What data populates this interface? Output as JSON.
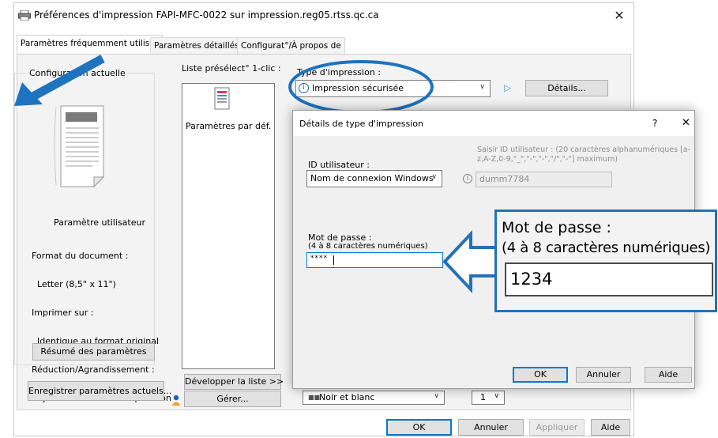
{
  "window": {
    "title": "Préférences d'impression FAPI-MFC-0022 sur impression.reg05.rtss.qc.ca",
    "close_glyph": "✕"
  },
  "tabs": [
    {
      "label": "Paramètres fréquemment utilisés",
      "active": true
    },
    {
      "label": "Paramètres détaillés",
      "active": false
    },
    {
      "label": "Configurat°/À propos de",
      "active": false
    }
  ],
  "left_panel": {
    "group_title": "Configuration actuelle",
    "user_setting_title": "Paramètre utilisateur",
    "details": [
      "Format du document :",
      "  Letter (8,5\" x 11\")",
      "Imprimer sur :",
      "  Identique au format original",
      "Réduction/Agrandissement :",
      "  Ajuster au format d'impression"
    ],
    "summary_button": "Résumé des paramètres",
    "save_button": "Enregistrer paramètres actuels..."
  },
  "preset_list": {
    "title": "Liste présélect° 1-clic :",
    "item_label": "Paramètres par déf.",
    "expand_button": "Développer la liste >>",
    "manage_button": "Gérer..."
  },
  "print_type": {
    "label": "Type d'impression :",
    "value": "Impression sécurisée",
    "details_button": "Détails..."
  },
  "color_combo": {
    "value": "Noir et blanc"
  },
  "copies_combo": {
    "value": "1"
  },
  "bottom_buttons": {
    "ok": "OK",
    "cancel": "Annuler",
    "apply": "Appliquer",
    "help": "Aide"
  },
  "sub_dialog": {
    "title": "Détails de type d'impression",
    "help_glyph": "?",
    "close_glyph": "✕",
    "user_id_label": "ID utilisateur :",
    "user_id_source": "Nom de connexion Windows",
    "user_id_hint": "Saisir ID utilisateur : (20 caractères alphanumériques [a-z,A-Z,0-9,\"_\",\"-\",\"-\",\"/\",\"-\"] maximum)",
    "user_id_value": "dumm7784",
    "password_label": "Mot de passe :",
    "password_hint": "(4 à 8 caractères numériques)",
    "password_value": "****",
    "ok": "OK",
    "cancel": "Annuler",
    "help": "Aide"
  },
  "callout": {
    "label": "Mot de passe :",
    "hint": "(4 à 8 caractères numériques)",
    "value": "1234"
  },
  "colors": {
    "annotation_blue": "#1e73be",
    "callout_border": "#2470b8",
    "focus_blue": "#0078d7"
  },
  "icons": {
    "printer": "printer-icon",
    "info": "info-icon",
    "play": "play-icon",
    "person": "person-icon",
    "document": "document-preview-icon"
  }
}
